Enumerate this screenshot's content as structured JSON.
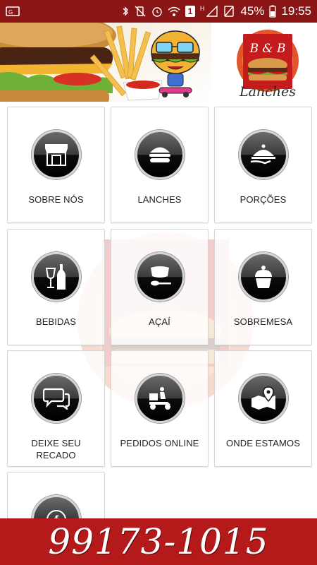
{
  "status_bar": {
    "battery_percent": "45%",
    "time": "19:55",
    "notification_count": "1",
    "network_letter": "H"
  },
  "header": {
    "logo_text_top": "B & B",
    "logo_text_bottom": "Lanches"
  },
  "menu": {
    "items": [
      {
        "label": "SOBRE NÓS",
        "icon": "store-icon"
      },
      {
        "label": "LANCHES",
        "icon": "burger-icon"
      },
      {
        "label": "PORÇÕES",
        "icon": "cloche-icon"
      },
      {
        "label": "BEBIDAS",
        "icon": "drinks-icon"
      },
      {
        "label": "AÇAÍ",
        "icon": "bowl-icon"
      },
      {
        "label": "SOBREMESA",
        "icon": "cupcake-icon"
      },
      {
        "label": "DEIXE SEU RECADO",
        "icon": "chat-icon"
      },
      {
        "label": "PEDIDOS ONLINE",
        "icon": "delivery-scooter-icon"
      },
      {
        "label": "ONDE ESTAMOS",
        "icon": "map-pin-icon"
      },
      {
        "label": "",
        "icon": "facebook-icon"
      }
    ]
  },
  "phone_banner": {
    "phone": "99173-1015"
  },
  "colors": {
    "status_bar": "#8a1515",
    "banner": "#b51a1a",
    "tile_border": "#d6d6d6"
  }
}
